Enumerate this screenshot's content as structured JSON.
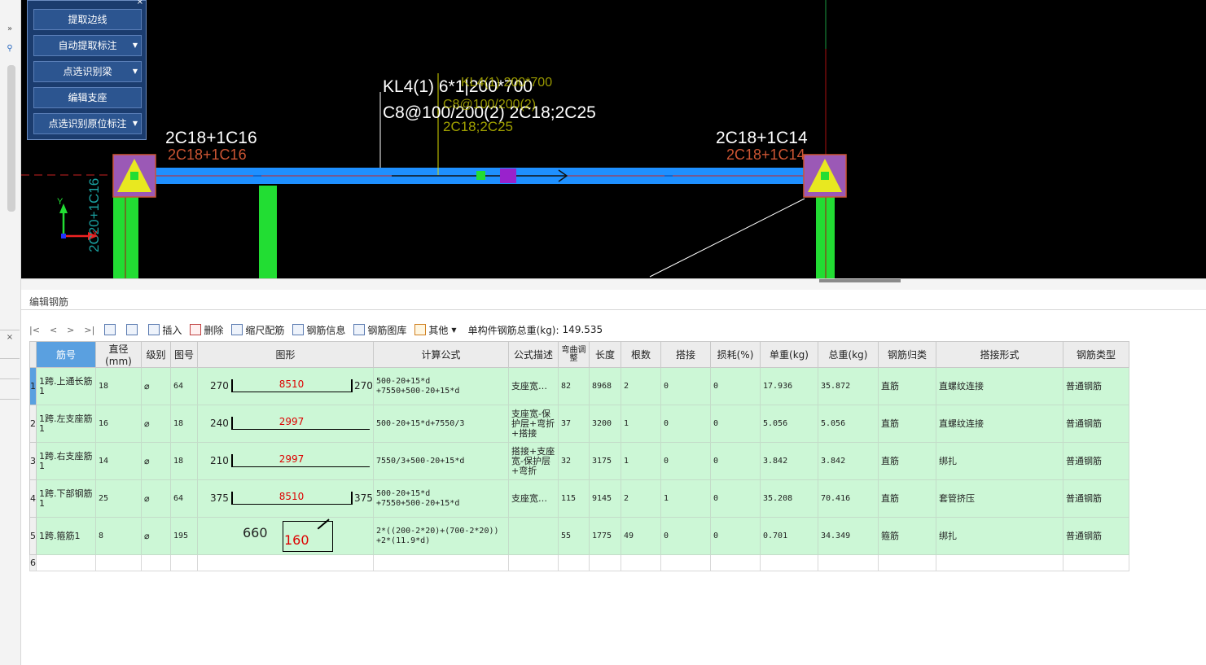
{
  "left_strip": {
    "expand_label": "»",
    "search_icon": "search-icon",
    "close_label": "×"
  },
  "cad": {
    "beam_label": "KL4(1) 6*1|200*700",
    "beam_label_ghost": "KL4(1) 200*700",
    "stirrup_label": "C8@100/200(2) 2C18;2C25",
    "stirrup_label_ghost": "C8@100/200(2)",
    "stirrup_label_ghost2": "2C18;2C25",
    "left_support_top": "2C18+1C16",
    "left_support_ghost": "2C18+1C16",
    "right_support_top": "2C18+1C14",
    "right_support_ghost": "2C18+1C14",
    "vertical_label": "2C20+1C16",
    "axis_x": "X",
    "axis_y": "Y"
  },
  "panel": {
    "close": "×",
    "buttons": [
      {
        "label": "提取边线",
        "dropdown": false
      },
      {
        "label": "自动提取标注",
        "dropdown": true
      },
      {
        "label": "点选识别梁",
        "dropdown": true
      },
      {
        "label": "编辑支座",
        "dropdown": false
      },
      {
        "label": "点选识别原位标注",
        "dropdown": true
      }
    ]
  },
  "editor": {
    "title": "编辑钢筋"
  },
  "toolbar": {
    "nav_first": "|<",
    "nav_prev": "<",
    "nav_next": ">",
    "nav_last": ">|",
    "insert": "插入",
    "delete": "删除",
    "scale": "缩尺配筋",
    "info": "钢筋信息",
    "library": "钢筋图库",
    "other": "其他",
    "total_label": "单构件钢筋总重(kg):",
    "total_value": "149.535"
  },
  "grid": {
    "headers": [
      "筋号",
      "直径(mm)",
      "级别",
      "图号",
      "图形",
      "计算公式",
      "公式描述",
      "弯曲调整",
      "长度",
      "根数",
      "搭接",
      "损耗(%)",
      "单重(kg)",
      "总重(kg)",
      "钢筋归类",
      "搭接形式",
      "钢筋类型"
    ],
    "rows": [
      {
        "n": "1",
        "name": "1跨.上通长筋1",
        "dia": "18",
        "grade": "⌀",
        "fig": "64",
        "left": "270",
        "mid": "8510",
        "right": "270",
        "formula": "500-20+15*d\n+7550+500-20+15*d",
        "desc": "支座宽…",
        "bend": "82",
        "len": "8968",
        "count": "2",
        "lap": "0",
        "loss": "0",
        "unit": "17.936",
        "total": "35.872",
        "cls": "直筋",
        "laptype": "直螺纹连接",
        "type": "普通钢筋"
      },
      {
        "n": "2",
        "name": "1跨.左支座筋1",
        "dia": "16",
        "grade": "⌀",
        "fig": "18",
        "left": "240",
        "mid": "2997",
        "right": "",
        "formula": "500-20+15*d+7550/3",
        "desc": "支座宽-保护层+弯折+搭接",
        "bend": "37",
        "len": "3200",
        "count": "1",
        "lap": "0",
        "loss": "0",
        "unit": "5.056",
        "total": "5.056",
        "cls": "直筋",
        "laptype": "直螺纹连接",
        "type": "普通钢筋"
      },
      {
        "n": "3",
        "name": "1跨.右支座筋1",
        "dia": "14",
        "grade": "⌀",
        "fig": "18",
        "left": "210",
        "mid": "2997",
        "right": "",
        "formula": "7550/3+500-20+15*d",
        "desc": "搭接+支座宽-保护层+弯折",
        "bend": "32",
        "len": "3175",
        "count": "1",
        "lap": "0",
        "loss": "0",
        "unit": "3.842",
        "total": "3.842",
        "cls": "直筋",
        "laptype": "绑扎",
        "type": "普通钢筋"
      },
      {
        "n": "4",
        "name": "1跨.下部钢筋1",
        "dia": "25",
        "grade": "⌀",
        "fig": "64",
        "left": "375",
        "mid": "8510",
        "right": "375",
        "formula": "500-20+15*d\n+7550+500-20+15*d",
        "desc": "支座宽…",
        "bend": "115",
        "len": "9145",
        "count": "2",
        "lap": "1",
        "loss": "0",
        "unit": "35.208",
        "total": "70.416",
        "cls": "直筋",
        "laptype": "套管挤压",
        "type": "普通钢筋"
      },
      {
        "n": "5",
        "name": "1跨.箍筋1",
        "dia": "8",
        "grade": "⌀",
        "fig": "195",
        "left": "660",
        "mid": "160",
        "right": "",
        "formula": "2*((200-2*20)+(700-2*20))\n+2*(11.9*d)",
        "desc": "",
        "bend": "55",
        "len": "1775",
        "count": "49",
        "lap": "0",
        "loss": "0",
        "unit": "0.701",
        "total": "34.349",
        "cls": "箍筋",
        "laptype": "绑扎",
        "type": "普通钢筋"
      }
    ],
    "empty_row_num": "6"
  },
  "colors": {
    "panel_bg": "#1b3c6e",
    "grid_row": "#ccf7d6",
    "header_selected": "#5aa0e0",
    "beam": "#1e90ff",
    "column": "#22dd33",
    "shape_value": "#dd0000"
  }
}
